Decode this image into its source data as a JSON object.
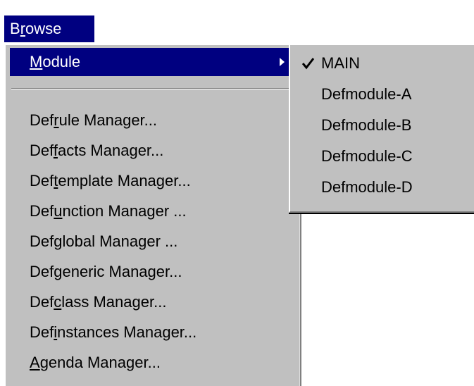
{
  "menubar": {
    "browse": {
      "pre": "B",
      "ul": "r",
      "post": "owse"
    }
  },
  "browse_menu": {
    "items": [
      {
        "pre": "",
        "ul": "M",
        "post": "odule"
      },
      {
        "pre": "Def",
        "ul": "r",
        "post": "ule Manager..."
      },
      {
        "pre": "Def",
        "ul": "f",
        "post": "acts Manager..."
      },
      {
        "pre": "Def",
        "ul": "t",
        "post": "emplate Manager..."
      },
      {
        "pre": "Def",
        "ul": "u",
        "post": "nction Manager ..."
      },
      {
        "pre": "Def",
        "ul": "g",
        "post": "lobal Manager ..."
      },
      {
        "pre": "Defgeneric Manager...",
        "ul": "",
        "post": ""
      },
      {
        "pre": "Def",
        "ul": "c",
        "post": "lass Manager..."
      },
      {
        "pre": "Def",
        "ul": "i",
        "post": "nstances Manager..."
      },
      {
        "pre": "",
        "ul": "A",
        "post": "genda Manager..."
      }
    ]
  },
  "module_submenu": {
    "items": [
      {
        "label": "MAIN",
        "checked": true
      },
      {
        "label": "Defmodule-A",
        "checked": false
      },
      {
        "label": "Defmodule-B",
        "checked": false
      },
      {
        "label": "Defmodule-C",
        "checked": false
      },
      {
        "label": "Defmodule-D",
        "checked": false
      }
    ]
  },
  "colors": {
    "highlight": "#000080",
    "menu_face": "#c0c0c0"
  },
  "icons": {
    "check": "check-icon",
    "submenu": "chevron-right-icon"
  }
}
